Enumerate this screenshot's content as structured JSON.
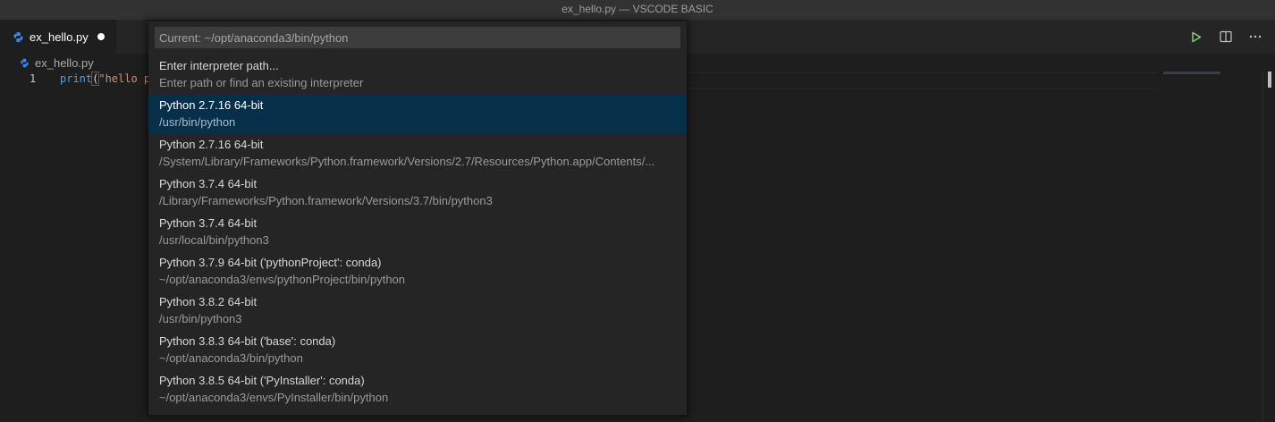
{
  "window": {
    "title": "ex_hello.py — VSCODE BASIC"
  },
  "tab": {
    "label": "ex_hello.py",
    "icon": "python-file-icon",
    "dirty": true
  },
  "editor_actions": [
    {
      "name": "run-python-file-button",
      "icon": "play-icon",
      "color": "#89d185"
    },
    {
      "name": "split-editor-button",
      "icon": "split-editor-icon"
    },
    {
      "name": "more-actions-button",
      "icon": "ellipsis-icon"
    }
  ],
  "breadcrumb": {
    "label": "ex_hello.py"
  },
  "editor": {
    "line_number": "1",
    "code": {
      "fn": "print",
      "open_paren": "(",
      "str": "\"hello p"
    }
  },
  "quick_pick": {
    "placeholder": "Current: ~/opt/anaconda3/bin/python",
    "items": [
      {
        "label": "Enter interpreter path...",
        "detail": "Enter path or find an existing interpreter",
        "selected": false
      },
      {
        "label": "Python 2.7.16 64-bit",
        "detail": "/usr/bin/python",
        "selected": true
      },
      {
        "label": "Python 2.7.16 64-bit",
        "detail": "/System/Library/Frameworks/Python.framework/Versions/2.7/Resources/Python.app/Contents/...",
        "selected": false
      },
      {
        "label": "Python 3.7.4 64-bit",
        "detail": "/Library/Frameworks/Python.framework/Versions/3.7/bin/python3",
        "selected": false
      },
      {
        "label": "Python 3.7.4 64-bit",
        "detail": "/usr/local/bin/python3",
        "selected": false
      },
      {
        "label": "Python 3.7.9 64-bit ('pythonProject': conda)",
        "detail": "~/opt/anaconda3/envs/pythonProject/bin/python",
        "selected": false
      },
      {
        "label": "Python 3.8.2 64-bit",
        "detail": "/usr/bin/python3",
        "selected": false
      },
      {
        "label": "Python 3.8.3 64-bit ('base': conda)",
        "detail": "~/opt/anaconda3/bin/python",
        "selected": false
      },
      {
        "label": "Python 3.8.5 64-bit ('PyInstaller': conda)",
        "detail": "~/opt/anaconda3/envs/PyInstaller/bin/python",
        "selected": false
      }
    ]
  },
  "colors": {
    "accent_selection": "#062f4a",
    "python_icon": "#3b8eea"
  }
}
